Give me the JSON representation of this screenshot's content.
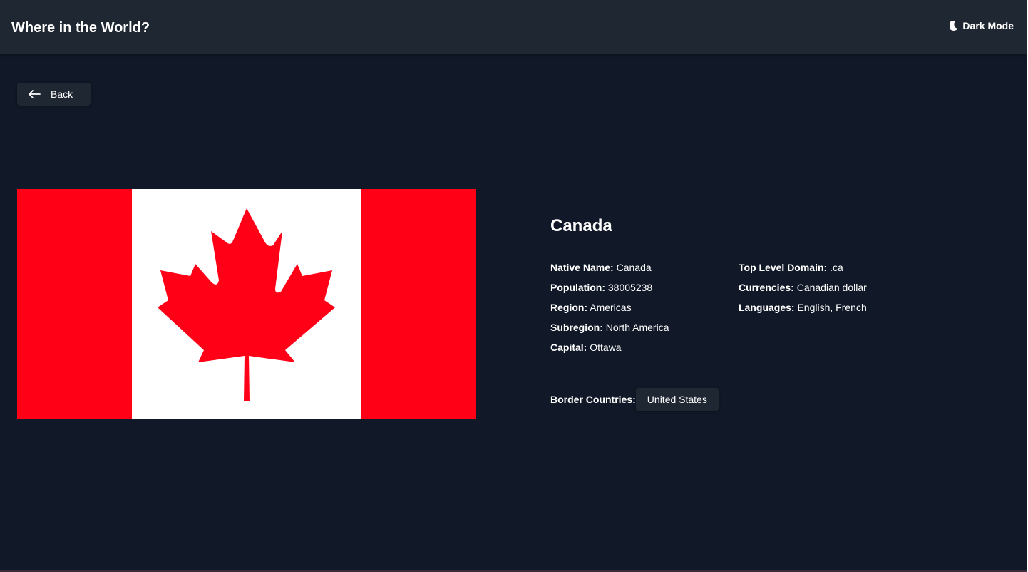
{
  "header": {
    "title": "Where in the World?",
    "mode_label": "Dark Mode",
    "mode_icon": "moon-icon"
  },
  "back_button": {
    "label": "Back",
    "icon": "arrow-left-icon"
  },
  "flag": {
    "icon": "canada-flag",
    "colors": {
      "red": "#ff0016",
      "white": "#ffffff"
    }
  },
  "country": {
    "name": "Canada",
    "left_details": [
      {
        "key": "Native Name:",
        "value": "Canada"
      },
      {
        "key": "Population:",
        "value": "38005238"
      },
      {
        "key": "Region:",
        "value": "Americas"
      },
      {
        "key": "Subregion:",
        "value": "North America"
      },
      {
        "key": "Capital:",
        "value": "Ottawa"
      }
    ],
    "right_details": [
      {
        "key": "Top Level Domain:",
        "value": ".ca"
      },
      {
        "key": "Currencies:",
        "value": "Canadian dollar"
      },
      {
        "key": "Languages:",
        "value": "English, French"
      }
    ],
    "border_label": "Border Countries:",
    "border_countries": [
      "United States"
    ]
  },
  "theme": {
    "background": "#111827",
    "surface": "#1f2732",
    "text": "#ffffff"
  }
}
